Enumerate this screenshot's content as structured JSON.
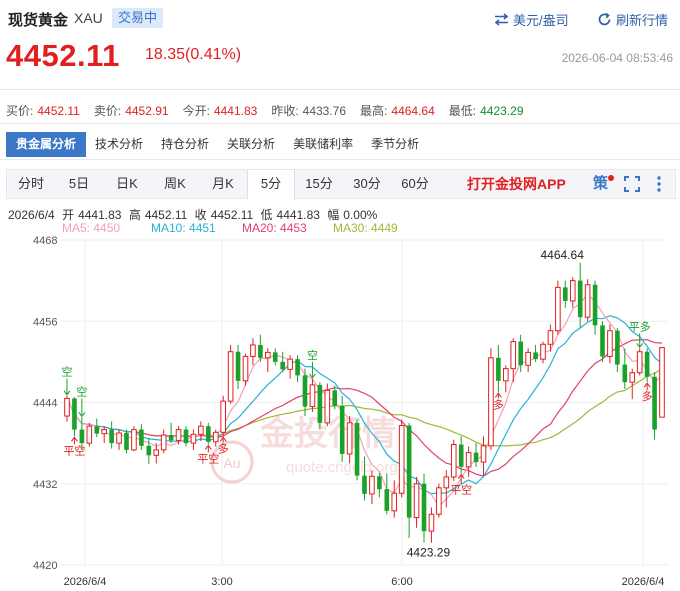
{
  "header": {
    "title": "现货黄金",
    "code": "XAU",
    "status_badge": "交易中",
    "unit_button": "美元/盎司",
    "refresh_button": "刷新行情"
  },
  "quote": {
    "price": "4452.11",
    "change": "18.35(0.41%)",
    "timestamp": "2026-06-04 08:53:46"
  },
  "stats": [
    {
      "label": "买价:",
      "value": "4452.11",
      "color": "#e02020"
    },
    {
      "label": "卖价:",
      "value": "4452.91",
      "color": "#e02020"
    },
    {
      "label": "今开:",
      "value": "4441.83",
      "color": "#e02020"
    },
    {
      "label": "昨收:",
      "value": "4433.76",
      "color": "#333333"
    },
    {
      "label": "最高:",
      "value": "4464.64",
      "color": "#e02020"
    },
    {
      "label": "最低:",
      "value": "4423.29",
      "color": "#10902a"
    }
  ],
  "analysis_tabs": [
    "贵金属分析",
    "技术分析",
    "持仓分析",
    "关联分析",
    "美联储利率",
    "季节分析"
  ],
  "period_tabs": [
    "分时",
    "5日",
    "日K",
    "周K",
    "月K",
    "5分",
    "15分",
    "30分",
    "60分"
  ],
  "active_period": "5分",
  "app_link": "打开金投网APP",
  "strategy_label": "策",
  "ohlc": {
    "date": "2026/6/4",
    "open_label": "开",
    "open": "4441.83",
    "high_label": "高",
    "high": "4452.11",
    "close_label": "收",
    "close": "4452.11",
    "low_label": "低",
    "low": "4441.83",
    "amp_label": "幅",
    "amp": "0.00%"
  },
  "ma_legend": [
    {
      "label": "MA5: 4450",
      "color": "#f4a0b8"
    },
    {
      "label": "MA10: 4451",
      "color": "#27b3d6"
    },
    {
      "label": "MA20: 4453",
      "color": "#e0406a"
    },
    {
      "label": "MA30: 4449",
      "color": "#9fb937"
    }
  ],
  "chart_data": {
    "type": "candlestick",
    "y_ticks": [
      "4468",
      "4456",
      "4444",
      "4432",
      "4420"
    ],
    "ylim": [
      4420,
      4468
    ],
    "x_ticks": [
      "2026/6/4",
      "3:00",
      "6:00",
      "2026/6/4"
    ],
    "annotations": {
      "max_label": "4464.64",
      "min_label": "4423.29"
    },
    "signals": [
      {
        "text": "空",
        "type": "short"
      },
      {
        "text": "空",
        "type": "short"
      },
      {
        "text": "平空",
        "type": "close-short"
      },
      {
        "text": "多",
        "type": "long"
      },
      {
        "text": "平空",
        "type": "close-short"
      },
      {
        "text": "空",
        "type": "short"
      },
      {
        "text": "多",
        "type": "long"
      },
      {
        "text": "平空",
        "type": "close-short"
      },
      {
        "text": "平多",
        "type": "close-long"
      },
      {
        "text": "多",
        "type": "long"
      }
    ],
    "watermark": "金投行情",
    "watermark_sub": "quote.cngold.org",
    "candles": [
      [
        4442.0,
        4445.0,
        4441.2,
        4444.6
      ],
      [
        4444.6,
        4444.8,
        4439.0,
        4440.0
      ],
      [
        4440.0,
        4441.8,
        4437.0,
        4438.0
      ],
      [
        4438.0,
        4441.0,
        4437.5,
        4440.5
      ],
      [
        4440.5,
        4441.6,
        4438.9,
        4439.4
      ],
      [
        4439.4,
        4440.5,
        4438.0,
        4440.0
      ],
      [
        4440.0,
        4441.2,
        4437.2,
        4438.0
      ],
      [
        4438.0,
        4440.0,
        4437.0,
        4439.5
      ],
      [
        4439.5,
        4440.0,
        4436.5,
        4437.0
      ],
      [
        4437.0,
        4440.5,
        4436.8,
        4440.0
      ],
      [
        4440.0,
        4440.8,
        4437.0,
        4437.6
      ],
      [
        4437.6,
        4438.8,
        4434.9,
        4436.2
      ],
      [
        4436.2,
        4438.0,
        4435.0,
        4437.0
      ],
      [
        4437.0,
        4440.0,
        4436.5,
        4439.2
      ],
      [
        4439.2,
        4441.0,
        4438.0,
        4438.4
      ],
      [
        4438.4,
        4440.5,
        4437.8,
        4440.0
      ],
      [
        4440.0,
        4440.5,
        4437.5,
        4438.0
      ],
      [
        4438.0,
        4440.0,
        4437.0,
        4439.3
      ],
      [
        4439.3,
        4441.2,
        4438.3,
        4440.5
      ],
      [
        4440.5,
        4441.0,
        4437.8,
        4438.2
      ],
      [
        4438.2,
        4440.0,
        4437.5,
        4439.6
      ],
      [
        4439.6,
        4445.0,
        4439.0,
        4444.2
      ],
      [
        4444.2,
        4452.5,
        4443.8,
        4451.5
      ],
      [
        4451.5,
        4452.5,
        4446.0,
        4447.2
      ],
      [
        4447.2,
        4451.2,
        4446.5,
        4450.8
      ],
      [
        4450.8,
        4453.5,
        4449.5,
        4452.5
      ],
      [
        4452.5,
        4454.0,
        4450.0,
        4450.6
      ],
      [
        4450.6,
        4452.0,
        4448.5,
        4451.4
      ],
      [
        4451.4,
        4452.0,
        4449.5,
        4450.0
      ],
      [
        4450.0,
        4451.5,
        4448.5,
        4448.9
      ],
      [
        4448.9,
        4451.0,
        4447.5,
        4450.4
      ],
      [
        4450.4,
        4451.0,
        4447.0,
        4448.0
      ],
      [
        4448.0,
        4449.0,
        4442.0,
        4443.4
      ],
      [
        4443.4,
        4447.5,
        4442.6,
        4446.6
      ],
      [
        4446.6,
        4447.0,
        4440.0,
        4441.0
      ],
      [
        4441.0,
        4446.8,
        4440.5,
        4445.8
      ],
      [
        4445.8,
        4446.5,
        4443.0,
        4443.5
      ],
      [
        4443.5,
        4445.0,
        4435.2,
        4436.4
      ],
      [
        4436.4,
        4442.0,
        4435.0,
        4441.0
      ],
      [
        4441.0,
        4441.5,
        4432.5,
        4433.2
      ],
      [
        4433.2,
        4436.0,
        4429.5,
        4430.5
      ],
      [
        4430.5,
        4434.0,
        4429.0,
        4433.1
      ],
      [
        4433.1,
        4433.6,
        4430.0,
        4431.2
      ],
      [
        4431.2,
        4433.5,
        4427.5,
        4428.0
      ],
      [
        4428.0,
        4432.5,
        4427.0,
        4430.6
      ],
      [
        4430.6,
        4441.5,
        4430.0,
        4440.6
      ],
      [
        4440.6,
        4441.0,
        4424.0,
        4427.0
      ],
      [
        4427.0,
        4433.0,
        4425.5,
        4432.0
      ],
      [
        4432.0,
        4433.5,
        4423.3,
        4425.0
      ],
      [
        4425.0,
        4428.5,
        4423.29,
        4427.5
      ],
      [
        4427.5,
        4432.0,
        4427.0,
        4431.4
      ],
      [
        4431.4,
        4434.0,
        4428.5,
        4433.0
      ],
      [
        4433.0,
        4438.5,
        4432.4,
        4437.8
      ],
      [
        4437.8,
        4439.0,
        4433.5,
        4434.5
      ],
      [
        4434.5,
        4437.5,
        4433.0,
        4436.6
      ],
      [
        4436.6,
        4438.0,
        4434.5,
        4435.2
      ],
      [
        4435.2,
        4439.0,
        4433.2,
        4437.6
      ],
      [
        4437.6,
        4452.0,
        4437.0,
        4450.6
      ],
      [
        4450.6,
        4452.5,
        4445.5,
        4447.2
      ],
      [
        4447.2,
        4449.5,
        4445.5,
        4449.0
      ],
      [
        4449.0,
        4453.5,
        4447.0,
        4453.0
      ],
      [
        4453.0,
        4454.0,
        4448.5,
        4449.5
      ],
      [
        4449.5,
        4452.0,
        4448.5,
        4451.4
      ],
      [
        4451.4,
        4452.5,
        4450.0,
        4450.4
      ],
      [
        4450.4,
        4453.0,
        4449.8,
        4452.6
      ],
      [
        4452.6,
        4455.5,
        4451.5,
        4454.6
      ],
      [
        4454.6,
        4462.0,
        4454.0,
        4461.0
      ],
      [
        4461.0,
        4462.0,
        4458.0,
        4459.0
      ],
      [
        4459.0,
        4462.5,
        4458.0,
        4462.0
      ],
      [
        4462.0,
        4464.64,
        4455.0,
        4456.6
      ],
      [
        4456.6,
        4462.2,
        4456.0,
        4461.4
      ],
      [
        4461.4,
        4462.0,
        4454.0,
        4455.4
      ],
      [
        4455.4,
        4456.0,
        4450.0,
        4450.8
      ],
      [
        4450.8,
        4455.5,
        4449.8,
        4454.6
      ],
      [
        4454.6,
        4455.0,
        4448.5,
        4449.6
      ],
      [
        4449.6,
        4452.0,
        4446.0,
        4447.0
      ],
      [
        4447.0,
        4449.0,
        4444.5,
        4448.4
      ],
      [
        4448.4,
        4452.0,
        4448.0,
        4451.5
      ],
      [
        4451.5,
        4452.0,
        4447.0,
        4447.8
      ],
      [
        4447.8,
        4448.5,
        4438.5,
        4440.0
      ],
      [
        4441.83,
        4452.11,
        4441.83,
        4452.11
      ]
    ]
  }
}
